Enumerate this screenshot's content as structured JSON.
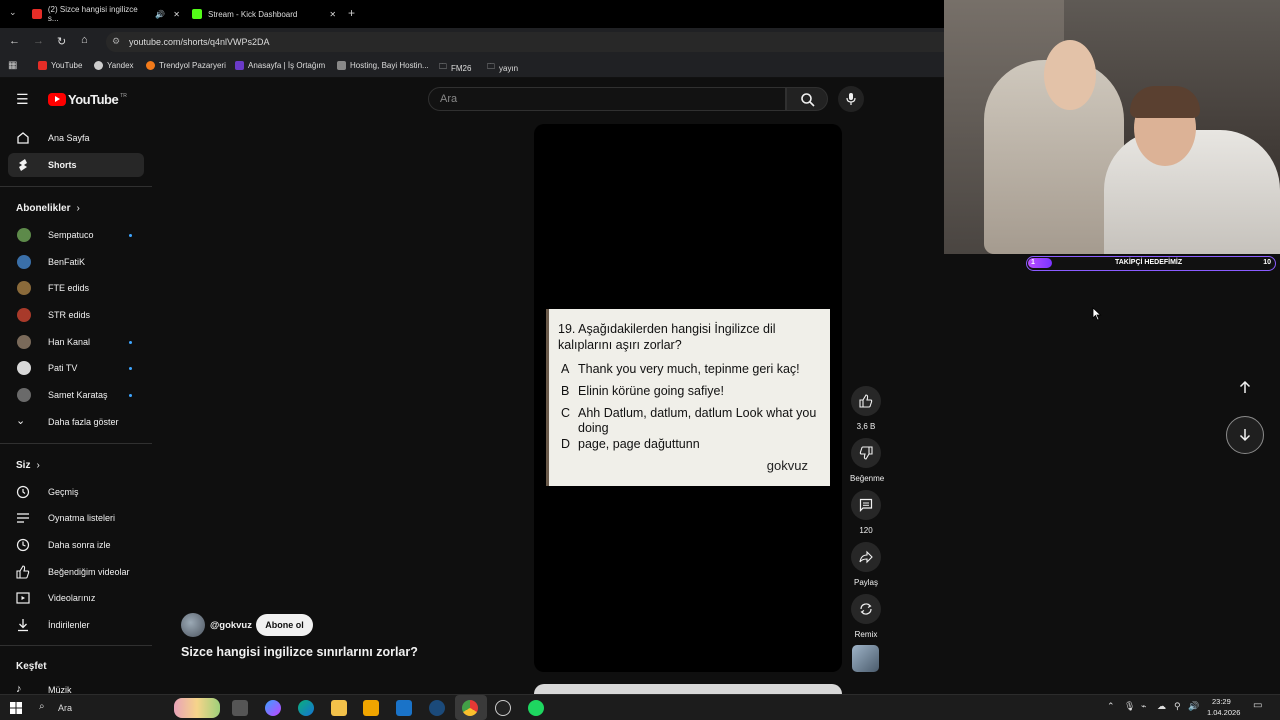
{
  "browser": {
    "tabs": [
      {
        "label": "(2) Sizce hangisi ingilizce s..."
      },
      {
        "label": "Stream - Kick Dashboard"
      }
    ],
    "url": "youtube.com/shorts/q4nlVWPs2DA",
    "bookmarks": [
      "YouTube",
      "Yandex",
      "Trendyol Pazaryeri",
      "Anasayfa | İş Ortağım",
      "Hosting, Bayi Hostin...",
      "FM26",
      "yayın"
    ]
  },
  "youtube": {
    "logo": "YouTube",
    "logo_region": "TR",
    "search_placeholder": "Ara"
  },
  "sidebar": {
    "main": [
      {
        "label": "Ana Sayfa",
        "icon": "home-icon"
      },
      {
        "label": "Shorts",
        "icon": "shorts-icon"
      }
    ],
    "subscriptions_title": "Abonelikler",
    "subscriptions": [
      {
        "label": "Sempatuco",
        "new": true,
        "color": "#5d8a4a"
      },
      {
        "label": "BenFatiK",
        "new": false,
        "color": "#3a6fa8"
      },
      {
        "label": "FTE edids",
        "new": false,
        "color": "#8a6a3a"
      },
      {
        "label": "STR edids",
        "new": false,
        "color": "#a83a2a"
      },
      {
        "label": "Han Kanal",
        "new": true,
        "color": "#7a6a5a"
      },
      {
        "label": "Pati TV",
        "new": true,
        "color": "#d8d8d8"
      },
      {
        "label": "Samet Karataş",
        "new": true,
        "color": "#6a6a6a"
      }
    ],
    "show_more": "Daha fazla göster",
    "you_title": "Siz",
    "you": [
      {
        "label": "Geçmiş"
      },
      {
        "label": "Oynatma listeleri"
      },
      {
        "label": "Daha sonra izle"
      },
      {
        "label": "Beğendiğim videolar"
      },
      {
        "label": "Videolarınız"
      },
      {
        "label": "İndirilenler"
      }
    ],
    "explore_title": "Keşfet",
    "explore": [
      {
        "label": "Müzik"
      }
    ]
  },
  "short": {
    "question": "19. Aşağıdakilerden hangisi İngilizce dil kalıplarını aşırı zorlar?",
    "options": [
      {
        "letter": "A",
        "text": "Thank you very much, tepinme geri kaç!"
      },
      {
        "letter": "B",
        "text": "Elinin körüne going safiye!"
      },
      {
        "letter": "C",
        "text": "Ahh Datlum, datlum, datlum Look what you doing"
      },
      {
        "letter": "D",
        "text": "page, page dağuttunn"
      }
    ],
    "watermark": "gokvuz",
    "channel": "@gokvuz",
    "subscribe": "Abone ol",
    "title": "Sizce hangisi ingilizce sınırlarını zorlar?"
  },
  "actions": {
    "likes": "3,6 B",
    "dislike": "Beğenme",
    "comments": "120",
    "share": "Paylaş",
    "remix": "Remix"
  },
  "stream_overlay": {
    "goal_label": "TAKİPÇİ HEDEFİMİZ",
    "goal_current": "1",
    "goal_target": "10"
  },
  "taskbar": {
    "search": "Ara",
    "time": "23:29",
    "date": "1.04.2026"
  }
}
